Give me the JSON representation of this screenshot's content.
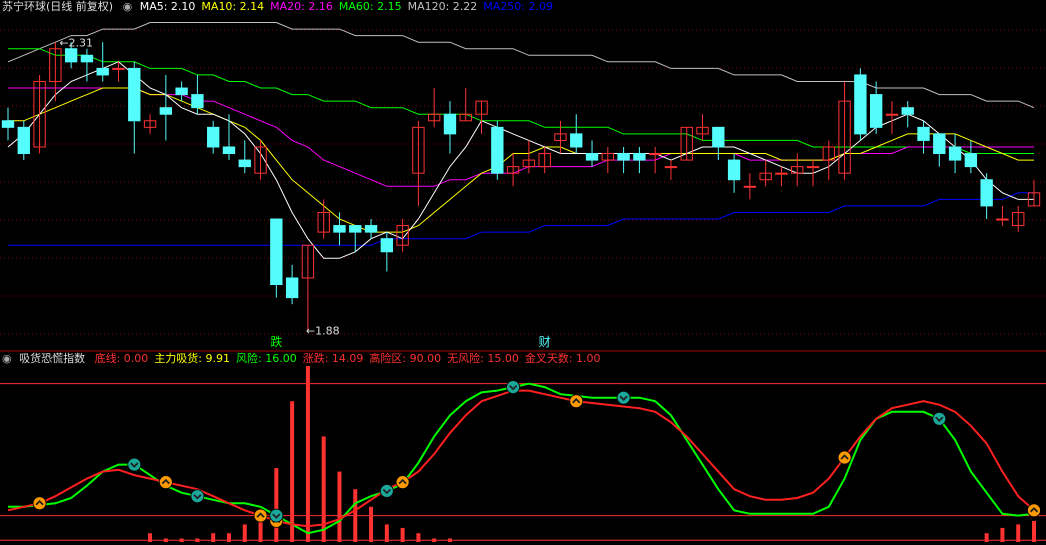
{
  "header": {
    "title": "苏宁环球(日线 前复权)",
    "indicators": [
      {
        "label": "MA5:",
        "value": "2.10",
        "color": "#ffffff"
      },
      {
        "label": "MA10:",
        "value": "2.14",
        "color": "#ffff00"
      },
      {
        "label": "MA20:",
        "value": "2.16",
        "color": "#ff00ff"
      },
      {
        "label": "MA60:",
        "value": "2.15",
        "color": "#00ff00"
      },
      {
        "label": "MA120:",
        "value": "2.22",
        "color": "#c0c0c0"
      },
      {
        "label": "MA250:",
        "value": "2.09",
        "color": "#0000ff"
      }
    ]
  },
  "indicator_header": {
    "title": "吸货恐慌指数",
    "items": [
      {
        "label": "底线:",
        "value": "0.00",
        "color": "#ff3030"
      },
      {
        "label": "主力吸货:",
        "value": "9.91",
        "color": "#ffff00"
      },
      {
        "label": "风险:",
        "value": "16.00",
        "color": "#00ff00"
      },
      {
        "label": "涨跌:",
        "value": "14.09",
        "color": "#ff3030"
      },
      {
        "label": "高险区:",
        "value": "90.00",
        "color": "#ff3030"
      },
      {
        "label": "无风险:",
        "value": "15.00",
        "color": "#ff3030"
      },
      {
        "label": "金叉天数:",
        "value": "1.00",
        "color": "#ff3030"
      }
    ]
  },
  "annotations": {
    "high_label": "2.31",
    "low_label": "1.88",
    "marker_die": "跌",
    "marker_cai": "财"
  },
  "colors": {
    "up": "#ff3232",
    "down": "#54fcfc",
    "ma5": "#ffffff",
    "ma10": "#ffff00",
    "ma20": "#ff00ff",
    "ma60": "#00ff00",
    "ma120": "#c0c0c0",
    "ma250": "#0000ff",
    "risk_line": "#00ff00",
    "price_line": "#ff2020",
    "hline": "#ff3030",
    "gold": "#ff9900",
    "teal": "#1aa89a"
  },
  "chart_data": {
    "type": "candlestick",
    "y_range": [
      1.85,
      2.36
    ],
    "candles": [
      [
        2.2,
        2.19,
        2.22,
        2.17
      ],
      [
        2.19,
        2.15,
        2.2,
        2.14
      ],
      [
        2.16,
        2.26,
        2.27,
        2.15
      ],
      [
        2.26,
        2.31,
        2.32,
        2.23
      ],
      [
        2.31,
        2.29,
        2.32,
        2.28
      ],
      [
        2.3,
        2.29,
        2.31,
        2.26
      ],
      [
        2.28,
        2.27,
        2.32,
        2.26
      ],
      [
        2.28,
        2.28,
        2.29,
        2.26
      ],
      [
        2.28,
        2.2,
        2.29,
        2.15
      ],
      [
        2.19,
        2.2,
        2.21,
        2.18
      ],
      [
        2.22,
        2.21,
        2.27,
        2.17
      ],
      [
        2.25,
        2.24,
        2.26,
        2.23
      ],
      [
        2.24,
        2.22,
        2.27,
        2.21
      ],
      [
        2.19,
        2.16,
        2.2,
        2.15
      ],
      [
        2.16,
        2.15,
        2.21,
        2.14
      ],
      [
        2.14,
        2.13,
        2.17,
        2.12
      ],
      [
        2.12,
        2.16,
        2.17,
        2.11
      ],
      [
        2.05,
        1.95,
        2.05,
        1.93
      ],
      [
        1.96,
        1.93,
        1.98,
        1.92
      ],
      [
        1.96,
        2.01,
        2.01,
        1.88
      ],
      [
        2.03,
        2.06,
        2.08,
        2.02
      ],
      [
        2.04,
        2.03,
        2.06,
        2.01
      ],
      [
        2.04,
        2.03,
        2.04,
        2.0
      ],
      [
        2.04,
        2.03,
        2.05,
        2.02
      ],
      [
        2.02,
        2.0,
        2.03,
        1.97
      ],
      [
        2.01,
        2.04,
        2.05,
        2.0
      ],
      [
        2.12,
        2.19,
        2.2,
        2.07
      ],
      [
        2.2,
        2.21,
        2.25,
        2.19
      ],
      [
        2.21,
        2.18,
        2.23,
        2.15
      ],
      [
        2.2,
        2.21,
        2.25,
        2.2
      ],
      [
        2.21,
        2.23,
        2.23,
        2.18
      ],
      [
        2.19,
        2.12,
        2.2,
        2.11
      ],
      [
        2.12,
        2.13,
        2.15,
        2.1
      ],
      [
        2.13,
        2.14,
        2.17,
        2.12
      ],
      [
        2.13,
        2.15,
        2.16,
        2.12
      ],
      [
        2.17,
        2.18,
        2.2,
        2.15
      ],
      [
        2.18,
        2.16,
        2.21,
        2.15
      ],
      [
        2.15,
        2.14,
        2.17,
        2.13
      ],
      [
        2.14,
        2.15,
        2.16,
        2.12
      ],
      [
        2.15,
        2.14,
        2.16,
        2.12
      ],
      [
        2.15,
        2.14,
        2.16,
        2.12
      ],
      [
        2.15,
        2.15,
        2.16,
        2.12
      ],
      [
        2.13,
        2.13,
        2.14,
        2.11
      ],
      [
        2.14,
        2.19,
        2.19,
        2.14
      ],
      [
        2.18,
        2.19,
        2.21,
        2.17
      ],
      [
        2.19,
        2.16,
        2.19,
        2.14
      ],
      [
        2.14,
        2.11,
        2.15,
        2.09
      ],
      [
        2.1,
        2.1,
        2.12,
        2.08
      ],
      [
        2.11,
        2.12,
        2.14,
        2.1
      ],
      [
        2.12,
        2.12,
        2.13,
        2.1
      ],
      [
        2.12,
        2.13,
        2.15,
        2.1
      ],
      [
        2.13,
        2.13,
        2.14,
        2.1
      ],
      [
        2.14,
        2.16,
        2.17,
        2.11
      ],
      [
        2.12,
        2.23,
        2.26,
        2.11
      ],
      [
        2.27,
        2.18,
        2.28,
        2.17
      ],
      [
        2.24,
        2.19,
        2.26,
        2.18
      ],
      [
        2.21,
        2.21,
        2.23,
        2.18
      ],
      [
        2.22,
        2.21,
        2.23,
        2.19
      ],
      [
        2.19,
        2.17,
        2.2,
        2.15
      ],
      [
        2.18,
        2.15,
        2.18,
        2.13
      ],
      [
        2.16,
        2.14,
        2.18,
        2.12
      ],
      [
        2.15,
        2.13,
        2.17,
        2.12
      ],
      [
        2.11,
        2.07,
        2.12,
        2.05
      ],
      [
        2.05,
        2.05,
        2.07,
        2.04
      ],
      [
        2.04,
        2.06,
        2.07,
        2.03
      ],
      [
        2.07,
        2.09,
        2.11,
        2.07
      ]
    ],
    "ma_series": {
      "ma5": [
        2.16,
        2.18,
        2.21,
        2.24,
        2.26,
        2.27,
        2.28,
        2.29,
        2.27,
        2.25,
        2.24,
        2.22,
        2.21,
        2.21,
        2.2,
        2.18,
        2.15,
        2.11,
        2.06,
        2.02,
        1.99,
        1.99,
        2.0,
        2.02,
        2.03,
        2.02,
        2.05,
        2.09,
        2.13,
        2.16,
        2.2,
        2.19,
        2.18,
        2.17,
        2.16,
        2.15,
        2.15,
        2.15,
        2.15,
        2.15,
        2.15,
        2.15,
        2.14,
        2.15,
        2.16,
        2.16,
        2.16,
        2.15,
        2.14,
        2.13,
        2.12,
        2.12,
        2.13,
        2.15,
        2.17,
        2.19,
        2.2,
        2.21,
        2.2,
        2.18,
        2.16,
        2.14,
        2.11,
        2.09,
        2.08,
        2.08
      ],
      "ma10": [
        2.2,
        2.2,
        2.21,
        2.22,
        2.23,
        2.24,
        2.25,
        2.25,
        2.25,
        2.24,
        2.24,
        2.23,
        2.22,
        2.21,
        2.2,
        2.19,
        2.17,
        2.14,
        2.11,
        2.09,
        2.07,
        2.05,
        2.04,
        2.03,
        2.03,
        2.03,
        2.04,
        2.06,
        2.08,
        2.1,
        2.12,
        2.13,
        2.15,
        2.15,
        2.16,
        2.16,
        2.15,
        2.15,
        2.15,
        2.15,
        2.15,
        2.15,
        2.15,
        2.15,
        2.15,
        2.15,
        2.15,
        2.15,
        2.15,
        2.14,
        2.14,
        2.14,
        2.14,
        2.15,
        2.15,
        2.16,
        2.17,
        2.18,
        2.18,
        2.18,
        2.18,
        2.17,
        2.16,
        2.15,
        2.14,
        2.14
      ],
      "ma20": [
        2.25,
        2.25,
        2.25,
        2.25,
        2.25,
        2.25,
        2.25,
        2.25,
        2.25,
        2.24,
        2.24,
        2.24,
        2.23,
        2.23,
        2.22,
        2.21,
        2.2,
        2.19,
        2.17,
        2.16,
        2.14,
        2.13,
        2.12,
        2.11,
        2.1,
        2.1,
        2.1,
        2.1,
        2.11,
        2.11,
        2.12,
        2.12,
        2.12,
        2.13,
        2.13,
        2.13,
        2.13,
        2.13,
        2.14,
        2.14,
        2.14,
        2.14,
        2.15,
        2.15,
        2.15,
        2.15,
        2.15,
        2.14,
        2.14,
        2.14,
        2.14,
        2.14,
        2.14,
        2.15,
        2.15,
        2.15,
        2.15,
        2.16,
        2.16,
        2.16,
        2.16,
        2.16,
        2.16,
        2.16,
        2.16,
        2.16
      ],
      "ma60": [
        2.31,
        2.31,
        2.31,
        2.3,
        2.3,
        2.3,
        2.29,
        2.29,
        2.29,
        2.28,
        2.28,
        2.28,
        2.27,
        2.27,
        2.26,
        2.26,
        2.25,
        2.25,
        2.24,
        2.24,
        2.23,
        2.23,
        2.23,
        2.22,
        2.22,
        2.22,
        2.21,
        2.21,
        2.21,
        2.21,
        2.2,
        2.2,
        2.2,
        2.2,
        2.19,
        2.19,
        2.19,
        2.19,
        2.19,
        2.18,
        2.18,
        2.18,
        2.18,
        2.18,
        2.17,
        2.17,
        2.17,
        2.17,
        2.17,
        2.17,
        2.17,
        2.16,
        2.16,
        2.16,
        2.16,
        2.16,
        2.16,
        2.16,
        2.16,
        2.16,
        2.16,
        2.15,
        2.15,
        2.15,
        2.15,
        2.15
      ],
      "ma120": [
        2.29,
        2.3,
        2.31,
        2.32,
        2.33,
        2.33,
        2.34,
        2.34,
        2.34,
        2.35,
        2.35,
        2.35,
        2.35,
        2.35,
        2.35,
        2.35,
        2.35,
        2.35,
        2.34,
        2.34,
        2.34,
        2.34,
        2.33,
        2.33,
        2.33,
        2.33,
        2.32,
        2.32,
        2.32,
        2.31,
        2.31,
        2.31,
        2.31,
        2.3,
        2.3,
        2.3,
        2.3,
        2.3,
        2.29,
        2.29,
        2.29,
        2.29,
        2.28,
        2.28,
        2.28,
        2.28,
        2.27,
        2.27,
        2.27,
        2.27,
        2.26,
        2.26,
        2.26,
        2.26,
        2.26,
        2.25,
        2.25,
        2.25,
        2.25,
        2.24,
        2.24,
        2.24,
        2.23,
        2.23,
        2.23,
        2.22
      ],
      "ma250": [
        2.01,
        2.01,
        2.01,
        2.01,
        2.01,
        2.01,
        2.01,
        2.01,
        2.01,
        2.01,
        2.01,
        2.01,
        2.01,
        2.01,
        2.01,
        2.01,
        2.01,
        2.01,
        2.01,
        2.01,
        2.01,
        2.01,
        2.01,
        2.01,
        2.02,
        2.02,
        2.02,
        2.02,
        2.02,
        2.02,
        2.03,
        2.03,
        2.03,
        2.03,
        2.04,
        2.04,
        2.04,
        2.04,
        2.04,
        2.05,
        2.05,
        2.05,
        2.05,
        2.05,
        2.05,
        2.05,
        2.06,
        2.06,
        2.06,
        2.06,
        2.06,
        2.06,
        2.06,
        2.07,
        2.07,
        2.07,
        2.07,
        2.07,
        2.07,
        2.08,
        2.08,
        2.08,
        2.08,
        2.08,
        2.09,
        2.09
      ]
    },
    "indicator": {
      "y_range": [
        0,
        100
      ],
      "high_line": 90,
      "low_line": 15,
      "risk": [
        20,
        20,
        21,
        22,
        25,
        32,
        40,
        44,
        44,
        38,
        32,
        28,
        26,
        24,
        22,
        22,
        20,
        15,
        10,
        5,
        7,
        12,
        22,
        26,
        29,
        33,
        45,
        60,
        72,
        80,
        85,
        86,
        88,
        90,
        88,
        84,
        83,
        82,
        82,
        82,
        82,
        80,
        72,
        58,
        44,
        30,
        18,
        16,
        16,
        16,
        16,
        16,
        20,
        36,
        58,
        70,
        74,
        74,
        74,
        70,
        58,
        40,
        28,
        16,
        15,
        16
      ],
      "price": [
        18,
        20,
        22,
        26,
        31,
        36,
        40,
        41,
        38,
        36,
        34,
        32,
        30,
        26,
        22,
        18,
        15,
        12,
        10,
        9,
        10,
        13,
        18,
        24,
        30,
        34,
        40,
        50,
        62,
        72,
        80,
        83,
        86,
        86,
        84,
        82,
        80,
        79,
        78,
        77,
        76,
        74,
        68,
        60,
        50,
        40,
        30,
        26,
        24,
        24,
        25,
        28,
        36,
        48,
        60,
        70,
        76,
        78,
        80,
        78,
        74,
        66,
        56,
        40,
        26,
        18
      ],
      "bars": [
        0,
        0,
        0,
        0,
        0,
        0,
        0,
        0,
        0,
        5,
        2,
        2,
        2,
        5,
        5,
        10,
        12,
        42,
        80,
        100,
        60,
        40,
        30,
        20,
        10,
        8,
        5,
        2,
        2,
        0,
        0,
        0,
        0,
        0,
        0,
        0,
        0,
        0,
        0,
        0,
        0,
        0,
        0,
        0,
        0,
        0,
        0,
        0,
        0,
        0,
        0,
        0,
        0,
        0,
        0,
        0,
        0,
        0,
        0,
        0,
        0,
        0,
        5,
        8,
        10,
        12
      ],
      "gold_markers": [
        2,
        10,
        16,
        17,
        25,
        36,
        53,
        65
      ],
      "teal_markers": [
        8,
        12,
        17,
        24,
        32,
        39,
        59
      ]
    }
  }
}
